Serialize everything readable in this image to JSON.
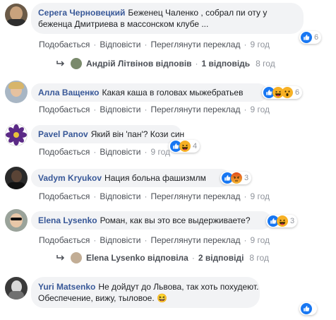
{
  "comments": [
    {
      "author": "Серега Черновецкий",
      "text": "Беженец Чаленко , собрал пи   оту у",
      "text2": "беженца Дмитриева в массонском клубе ...",
      "time": "9 год",
      "count": "6"
    },
    {
      "author": "Алла Ващенко",
      "text": "Какая каша в головах мыжебратьев",
      "time": "9 год",
      "count": "6"
    },
    {
      "author": "Pavel Panov",
      "text": "Який він 'пан'? Кози син",
      "time": "9 год",
      "count": "4"
    },
    {
      "author": "Vadym Kryukov",
      "text": "Нация больна фашизмлм",
      "time": "9 год",
      "count": "3"
    },
    {
      "author": "Elena Lysenko",
      "text": "Роман, как вы это все выдерживаете?",
      "time": "9 год",
      "count": "3"
    },
    {
      "author": "Yuri Matsenko",
      "text": "Не дойдут до Львова, так хоть похудеют.",
      "text2": "Обеспечение, вижу, тыловое. 😆",
      "count": ""
    }
  ],
  "actions": {
    "like": "Подобається",
    "reply": "Відповісти",
    "translate": "Переглянути переклад",
    "sep": "·"
  },
  "replies": [
    {
      "name": "Андрій Літвінов відповів",
      "sep": "·",
      "count_text": "1 відповідь",
      "time": "8 год"
    },
    {
      "name": "Elena Lysenko відповіла",
      "sep": "·",
      "count_text": "2 відповіді",
      "time": "8 год"
    }
  ],
  "colors": {
    "link": "#385898",
    "bubble": "#f2f3f5",
    "like": "#1877f2",
    "angry": "#e9710f",
    "haha": "#f7b125"
  },
  "icons": [
    "reply-arrow-icon",
    "like-reaction-icon",
    "haha-reaction-icon",
    "wow-reaction-icon",
    "angry-reaction-icon",
    "laughing-emoji-icon"
  ]
}
